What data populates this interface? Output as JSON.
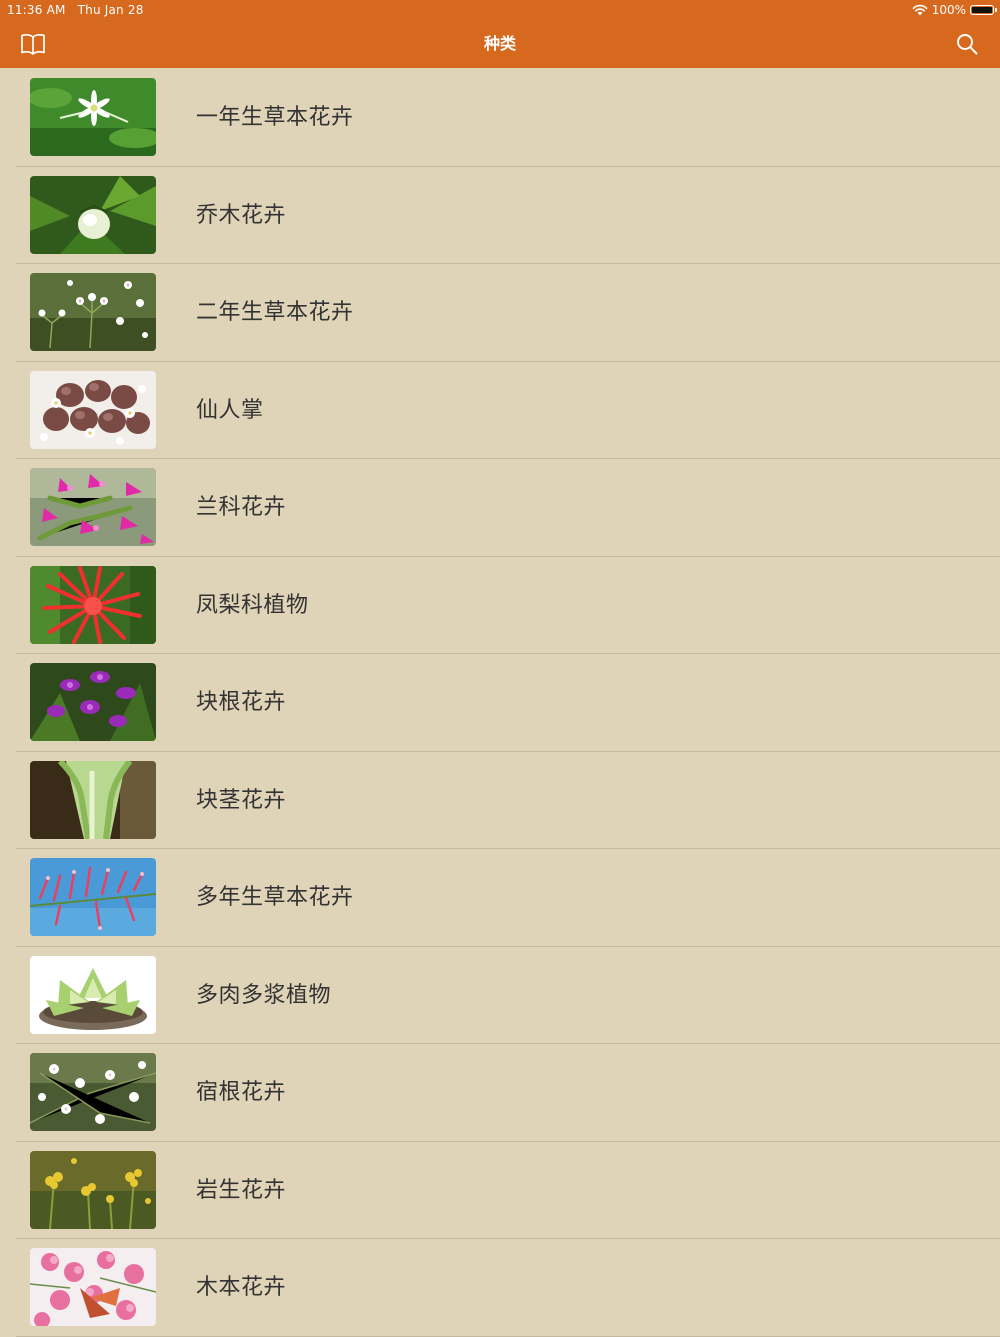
{
  "status_bar": {
    "time": "11:36 AM",
    "date": "Thu Jan 28",
    "battery": "100%",
    "battery_level": 1.0
  },
  "nav": {
    "title": "种类",
    "left_icon": "book-icon",
    "right_icon": "search-icon"
  },
  "colors": {
    "nav_background": "#d7691f",
    "list_background": "#e0d4b8",
    "separator": "#c4b8a0",
    "label_text": "#333333"
  },
  "categories": [
    {
      "label": "一年生草本花卉",
      "thumbnail": "white-star-flower-on-green"
    },
    {
      "label": "乔木花卉",
      "thumbnail": "white-bud-with-green-leaves"
    },
    {
      "label": "二年生草本花卉",
      "thumbnail": "small-white-flower-clusters"
    },
    {
      "label": "仙人掌",
      "thumbnail": "brown-stone-succulents"
    },
    {
      "label": "兰科花卉",
      "thumbnail": "pink-cactus-flowers"
    },
    {
      "label": "凤梨科植物",
      "thumbnail": "red-spiky-flower"
    },
    {
      "label": "块根花卉",
      "thumbnail": "purple-orchid-flowers"
    },
    {
      "label": "块茎花卉",
      "thumbnail": "green-pale-stem"
    },
    {
      "label": "多年生草本花卉",
      "thumbnail": "red-flowers-on-blue-sky"
    },
    {
      "label": "多肉多浆植物",
      "thumbnail": "green-rosette-succulent"
    },
    {
      "label": "宿根花卉",
      "thumbnail": "white-small-flowers"
    },
    {
      "label": "岩生花卉",
      "thumbnail": "yellow-flower-clusters"
    },
    {
      "label": "木本花卉",
      "thumbnail": "pink-crape-myrtle-flowers"
    }
  ]
}
